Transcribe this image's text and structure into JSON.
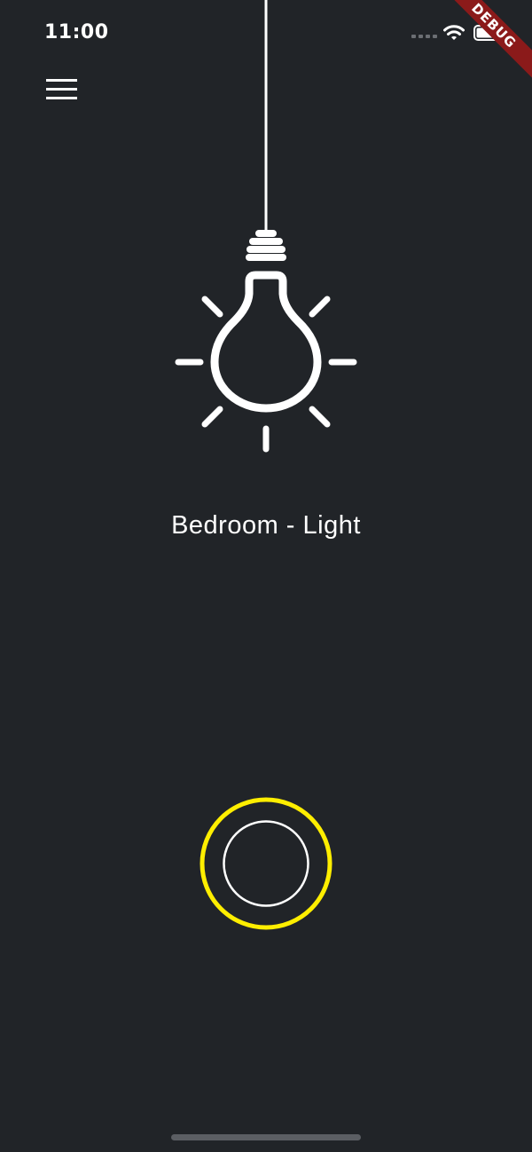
{
  "status_bar": {
    "time": "11:00",
    "icons": [
      "signal-dots-icon",
      "wifi-icon",
      "battery-icon"
    ]
  },
  "debug_banner": {
    "label": "DEBUG",
    "color": "#8b1a1a"
  },
  "header": {
    "menu_icon": "hamburger-menu-icon"
  },
  "device": {
    "name": "Bedroom - Light",
    "icon": "light-bulb-icon",
    "state": "off"
  },
  "power_button": {
    "icon": "power-toggle-icon",
    "ring_color": "#ffee00"
  },
  "theme": {
    "background": "#212428",
    "foreground": "#ffffff",
    "accent": "#ffee00"
  }
}
